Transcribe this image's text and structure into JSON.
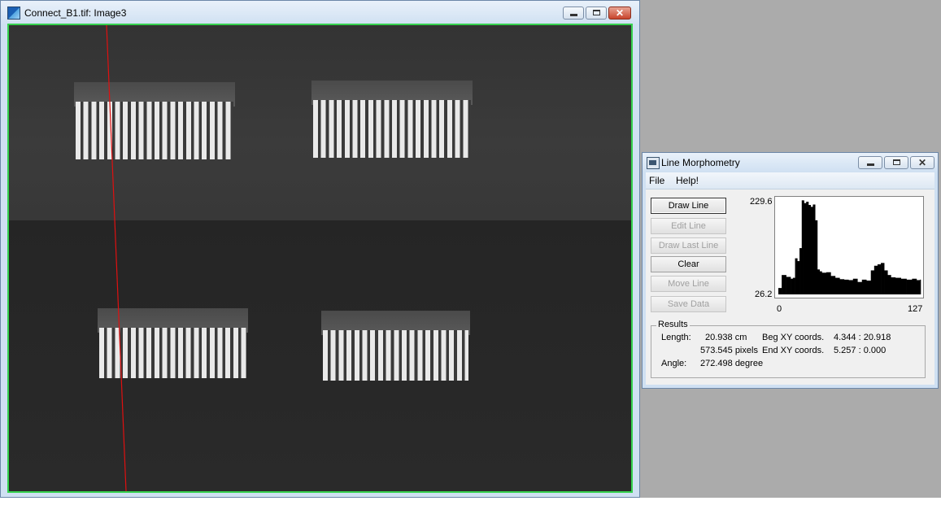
{
  "image_window": {
    "title": "Connect_B1.tif: Image3",
    "controls": {
      "minimize": "",
      "maximize": "",
      "close": "✕"
    }
  },
  "dialog": {
    "title": "Line Morphometry",
    "menu": [
      "File",
      "Help!"
    ],
    "buttons": [
      {
        "label": "Draw Line",
        "enabled": true
      },
      {
        "label": "Edit Line",
        "enabled": false
      },
      {
        "label": "Draw Last Line",
        "enabled": false
      },
      {
        "label": "Clear",
        "enabled": true
      },
      {
        "label": "Move Line",
        "enabled": false
      },
      {
        "label": "Save Data",
        "enabled": false
      }
    ],
    "results": {
      "legend": "Results",
      "length_label": "Length:",
      "length_cm": "20.938 cm",
      "length_pixels": "573.545 pixels",
      "beg_label": "Beg XY coords.",
      "beg_value": "4.344 : 20.918",
      "end_label": "End XY coords.",
      "end_value": "5.257 : 0.000",
      "angle_label": "Angle:",
      "angle_value": "272.498 degree"
    }
  },
  "chart_data": {
    "type": "area",
    "y_max_label": "229.6",
    "y_min_label": "26.2",
    "x_min_label": "0",
    "x_max_label": "127",
    "ylim": [
      26.2,
      229.6
    ],
    "xlim": [
      0,
      127
    ],
    "x": [
      0,
      3,
      7,
      11,
      13,
      15,
      17,
      19,
      21,
      23,
      25,
      27,
      29,
      31,
      33,
      35,
      37,
      39,
      43,
      47,
      51,
      55,
      59,
      63,
      67,
      71,
      75,
      79,
      83,
      86,
      89,
      92,
      95,
      98,
      101,
      105,
      110,
      115,
      120,
      124,
      127
    ],
    "values": [
      40,
      68,
      64,
      60,
      62,
      104,
      98,
      126,
      229,
      223,
      226,
      219,
      215,
      220,
      186,
      80,
      76,
      73,
      74,
      66,
      62,
      59,
      58,
      57,
      60,
      53,
      58,
      56,
      78,
      88,
      91,
      94,
      78,
      68,
      63,
      62,
      60,
      58,
      60,
      57,
      58
    ]
  }
}
